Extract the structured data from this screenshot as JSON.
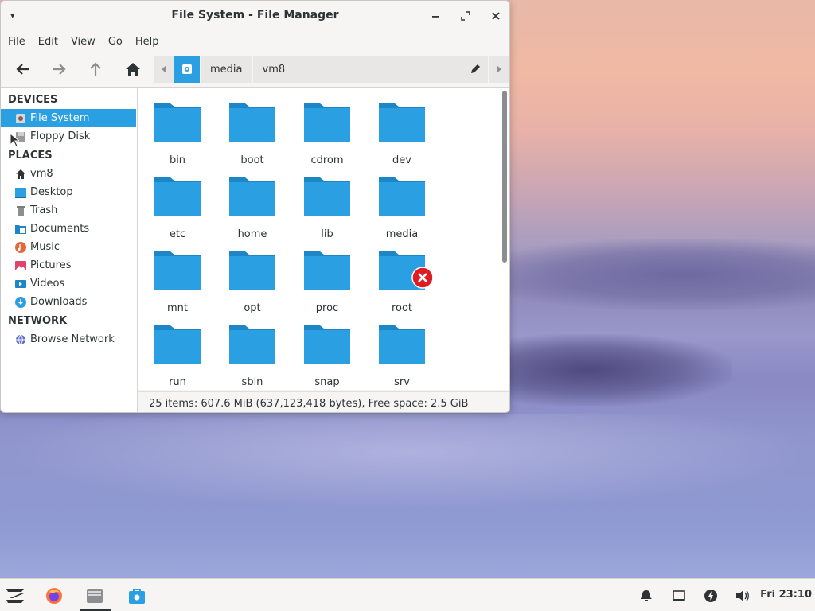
{
  "window": {
    "title": "File System - File Manager",
    "menus": [
      "File",
      "Edit",
      "View",
      "Go",
      "Help"
    ]
  },
  "pathbar": {
    "segments": [
      "media",
      "vm8"
    ]
  },
  "sidebar": {
    "devices_heading": "DEVICES",
    "devices": [
      {
        "label": "File System",
        "icon": "harddisk-icon",
        "selected": true
      },
      {
        "label": "Floppy Disk",
        "icon": "floppy-icon",
        "selected": false
      }
    ],
    "places_heading": "PLACES",
    "places": [
      {
        "label": "vm8",
        "icon": "home-icon"
      },
      {
        "label": "Desktop",
        "icon": "desktop-icon"
      },
      {
        "label": "Trash",
        "icon": "trash-icon"
      },
      {
        "label": "Documents",
        "icon": "documents-icon"
      },
      {
        "label": "Music",
        "icon": "music-icon"
      },
      {
        "label": "Pictures",
        "icon": "pictures-icon"
      },
      {
        "label": "Videos",
        "icon": "videos-icon"
      },
      {
        "label": "Downloads",
        "icon": "downloads-icon"
      }
    ],
    "network_heading": "NETWORK",
    "network": [
      {
        "label": "Browse Network",
        "icon": "network-icon"
      }
    ]
  },
  "folders": [
    {
      "name": "bin"
    },
    {
      "name": "boot"
    },
    {
      "name": "cdrom"
    },
    {
      "name": "dev"
    },
    {
      "name": "etc"
    },
    {
      "name": "home"
    },
    {
      "name": "lib"
    },
    {
      "name": "media"
    },
    {
      "name": "mnt"
    },
    {
      "name": "opt"
    },
    {
      "name": "proc"
    },
    {
      "name": "root",
      "locked": true
    },
    {
      "name": "run"
    },
    {
      "name": "sbin"
    },
    {
      "name": "snap"
    },
    {
      "name": "srv"
    }
  ],
  "status": {
    "text": "25 items: 607.6 MiB (637,123,418 bytes), Free space: 2.5 GiB"
  },
  "taskbar": {
    "clock": "Fri 23:10"
  },
  "colors": {
    "accent": "#2a9fe1",
    "folder": "#2a9fe1",
    "folder_tab": "#1c86c6",
    "error": "#e01b24"
  }
}
